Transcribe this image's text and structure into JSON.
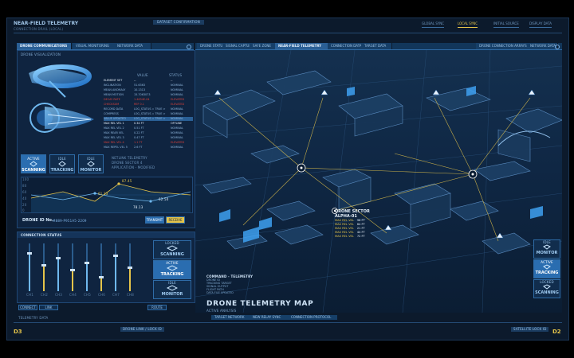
{
  "header": {
    "title": "NEAR-FIELD TELEMETRY",
    "subtitle": "CONNECTION DRAIL (LOCAL)",
    "center_label": "DATASET CONFIRMATION",
    "menu": [
      "GLOBAL SYNC",
      "LOCAL SYNC",
      "INITIAL SOURCE",
      "DISPLAY DATA"
    ]
  },
  "left_tabs": [
    "DRONE COMMUNICATIONS",
    "VISUAL MONITORING",
    "NETWORK DATA"
  ],
  "drone_panel": {
    "sub_label": "DRONE VISUALIZATION",
    "col_headers": [
      "VALUE",
      "STATUS"
    ],
    "params": [
      {
        "name": "ELEMENT SET",
        "value": "--",
        "status": "--",
        "color": "white"
      },
      {
        "name": "INCLINATION",
        "value": "51.6363",
        "status": "NOMINAL",
        "color": "blue"
      },
      {
        "name": "MEAN ANOMALY",
        "value": "10.1313",
        "status": "NOMINAL",
        "color": "blue"
      },
      {
        "name": "MEAN MOTION",
        "value": "15.7063073",
        "status": "NOMINAL",
        "color": "blue"
      },
      {
        "name": "DECAY RATE",
        "value": "1.4634E-04",
        "status": "ELEVATED",
        "color": "red"
      },
      {
        "name": "CHECKSUM",
        "value": "REF 0.1",
        "status": "ELEVATED",
        "color": "red"
      },
      {
        "name": "RECORD DATA",
        "value": "LOG_STATUS = TRUE >",
        "status": "NOMINAL",
        "color": "blue"
      },
      {
        "name": "COMPRESS",
        "value": "LOG_STATUS = TRUE >",
        "status": "NOMINAL",
        "color": "blue"
      },
      {
        "name": "VALUE UPDATED",
        "value": "LOG_STATUS = TRUE >",
        "status": "NOMINAL",
        "color": "blue"
      },
      {
        "name": "MAX REL VEL 1",
        "value": "0.34 FT",
        "status": "OFFLINE",
        "color": "white"
      },
      {
        "name": "MAX REL VEL 2",
        "value": "0.51 FT",
        "status": "NOMINAL",
        "color": "blue"
      },
      {
        "name": "MAX REAR VEL",
        "value": "0.22 FT",
        "status": "NOMINAL",
        "color": "blue"
      },
      {
        "name": "MAX REL VEL 3",
        "value": "0.47 FT",
        "status": "NOMINAL",
        "color": "blue"
      },
      {
        "name": "MAX REL VEL 4",
        "value": "1.1 FT",
        "status": "ELEVATED",
        "color": "red"
      },
      {
        "name": "MAX REPEL VEL 5",
        "value": "2.6 FT",
        "status": "NOMINAL",
        "color": "blue"
      }
    ],
    "mode_buttons": [
      "SCANNING",
      "TRACKING",
      "MONITOR"
    ],
    "mode_tags": [
      "ACTIVE",
      "IDLE",
      "IDLE"
    ],
    "notes": [
      "NETLINK TELEMETRY",
      "DRONE SECTOR 4",
      "APPLICATION - MODIFIED"
    ],
    "graph_values": [
      "87.45",
      "61.33",
      "62.50",
      "78.13"
    ],
    "graph_ticks": [
      "100",
      "80",
      "60",
      "40",
      "20",
      "0"
    ],
    "drone_id_label": "DRONE ID No.",
    "drone_id_value": "M889-P951A5-2209",
    "id_buttons": [
      "TRANSMIT",
      "RECEIVE"
    ]
  },
  "connection_panel": {
    "title": "CONNECTION STATUS",
    "slider_labels": [
      "CH1",
      "CH2",
      "CH3",
      "CH4",
      "CH5",
      "CH6",
      "CH7",
      "CH8"
    ],
    "levels": [
      0.8,
      0.55,
      0.7,
      0.45,
      0.6,
      0.3,
      0.75,
      0.5
    ],
    "mode_buttons": [
      "SCANNING",
      "TRACKING",
      "MONITOR"
    ],
    "mode_tags": [
      "LOCKED",
      "ACTIVE",
      "IDLE"
    ],
    "footer": [
      "CONNECT",
      "LINK",
      "ROUTE"
    ]
  },
  "map": {
    "tabs": [
      "DRONE STATUS",
      "SIGNAL CAPTURE",
      "SAFE ZONE",
      "NEAR-FIELD TELEMETRY",
      "CONNECTION DATA",
      "TARGET DATA",
      "DRONE CONNECTION ARRAYS",
      "NETWORK DATA"
    ],
    "sector_title": "DRONE SECTOR",
    "sector_id": "ALPHA-01",
    "sector_rows": [
      "MAX REL VEL",
      "MAX REL VEL",
      "MAX REL VEL",
      "MAX REL VEL",
      "MAX REL VEL"
    ],
    "sector_values": [
      "98 FT",
      "64 FT",
      "21 FT",
      "44 FT",
      "72 FT"
    ],
    "cmd_title": "COMMAND - TELEMETRY",
    "cmd_rows": [
      "DRONE ID",
      "TRACKING TARGET",
      "SIGNAL OUTPUT",
      "FLIGHT PATH",
      "DATA FILE UPDATED"
    ],
    "map_title": "DRONE TELEMETRY MAP",
    "map_subtitle": "ACTIVE ANALYSIS",
    "bottom_tabs": [
      "TARGET NETWORK",
      "NEW RELAY SYNC",
      "CONNECTION PROTOCOL"
    ],
    "right_buttons": [
      "MONITOR",
      "TRACKING",
      "SCANNING"
    ],
    "right_tags": [
      "IDLE",
      "ACTIVE",
      "LOCKED"
    ]
  },
  "footer": {
    "left_code": "D3",
    "left_status": "TELEMETRY DATA",
    "left_link": "DRONE LINK / LOCK ID",
    "right_link": "SATELLITE LOCK ID",
    "right_code": "D2"
  },
  "colors": {
    "background": "#0c1a2c",
    "panel": "#0f2440",
    "accent": "#2a6db0",
    "highlight": "#e5c44a",
    "alert": "#d9423a"
  }
}
